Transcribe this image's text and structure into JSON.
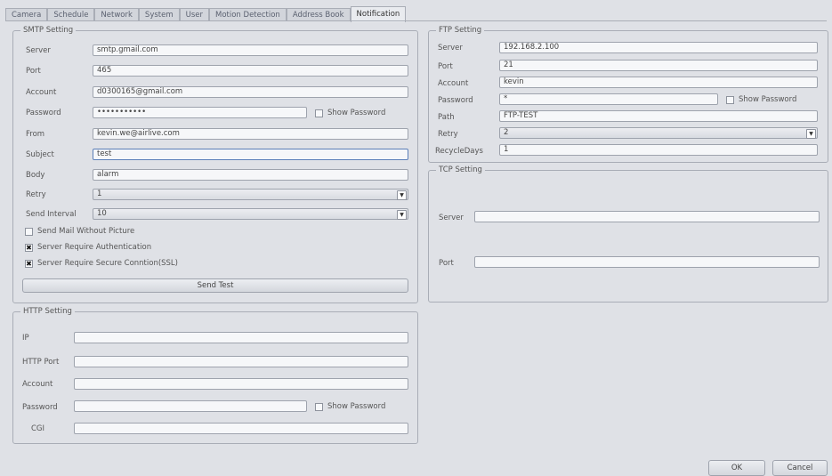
{
  "tabs": [
    "Camera",
    "Schedule",
    "Network",
    "System",
    "User",
    "Motion Detection",
    "Address Book",
    "Notification"
  ],
  "smtp": {
    "legend": "SMTP Setting",
    "server_label": "Server",
    "server_value": "smtp.gmail.com",
    "port_label": "Port",
    "port_value": "465",
    "account_label": "Account",
    "account_value": "d0300165@gmail.com",
    "password_label": "Password",
    "password_value": "•••••••••••",
    "show_password": "Show Password",
    "from_label": "From",
    "from_value": "kevin.we@airlive.com",
    "subject_label": "Subject",
    "subject_value": "test",
    "body_label": "Body",
    "body_value": "alarm",
    "retry_label": "Retry",
    "retry_value": "1",
    "interval_label": "Send Interval",
    "interval_value": "10",
    "no_picture": "Send Mail Without Picture",
    "auth": "Server Require Authentication",
    "ssl": "Server Require Secure Conntion(SSL)",
    "send_test": "Send Test"
  },
  "ftp": {
    "legend": "FTP Setting",
    "server_label": "Server",
    "server_value": "192.168.2.100",
    "port_label": "Port",
    "port_value": "21",
    "account_label": "Account",
    "account_value": "kevin",
    "password_label": "Password",
    "password_value": "*",
    "show_password": "Show Password",
    "path_label": "Path",
    "path_value": "FTP-TEST",
    "retry_label": "Retry",
    "retry_value": "2",
    "recycle_label": "RecycleDays",
    "recycle_value": "1"
  },
  "tcp": {
    "legend": "TCP Setting",
    "server_label": "Server",
    "server_value": "",
    "port_label": "Port",
    "port_value": ""
  },
  "http": {
    "legend": "HTTP Setting",
    "ip_label": "IP",
    "ip_value": "",
    "port_label": "HTTP Port",
    "port_value": "",
    "account_label": "Account",
    "account_value": "",
    "password_label": "Password",
    "password_value": "",
    "show_password": "Show Password",
    "cgi_label": "CGI",
    "cgi_value": ""
  },
  "buttons": {
    "ok": "OK",
    "cancel": "Cancel"
  }
}
